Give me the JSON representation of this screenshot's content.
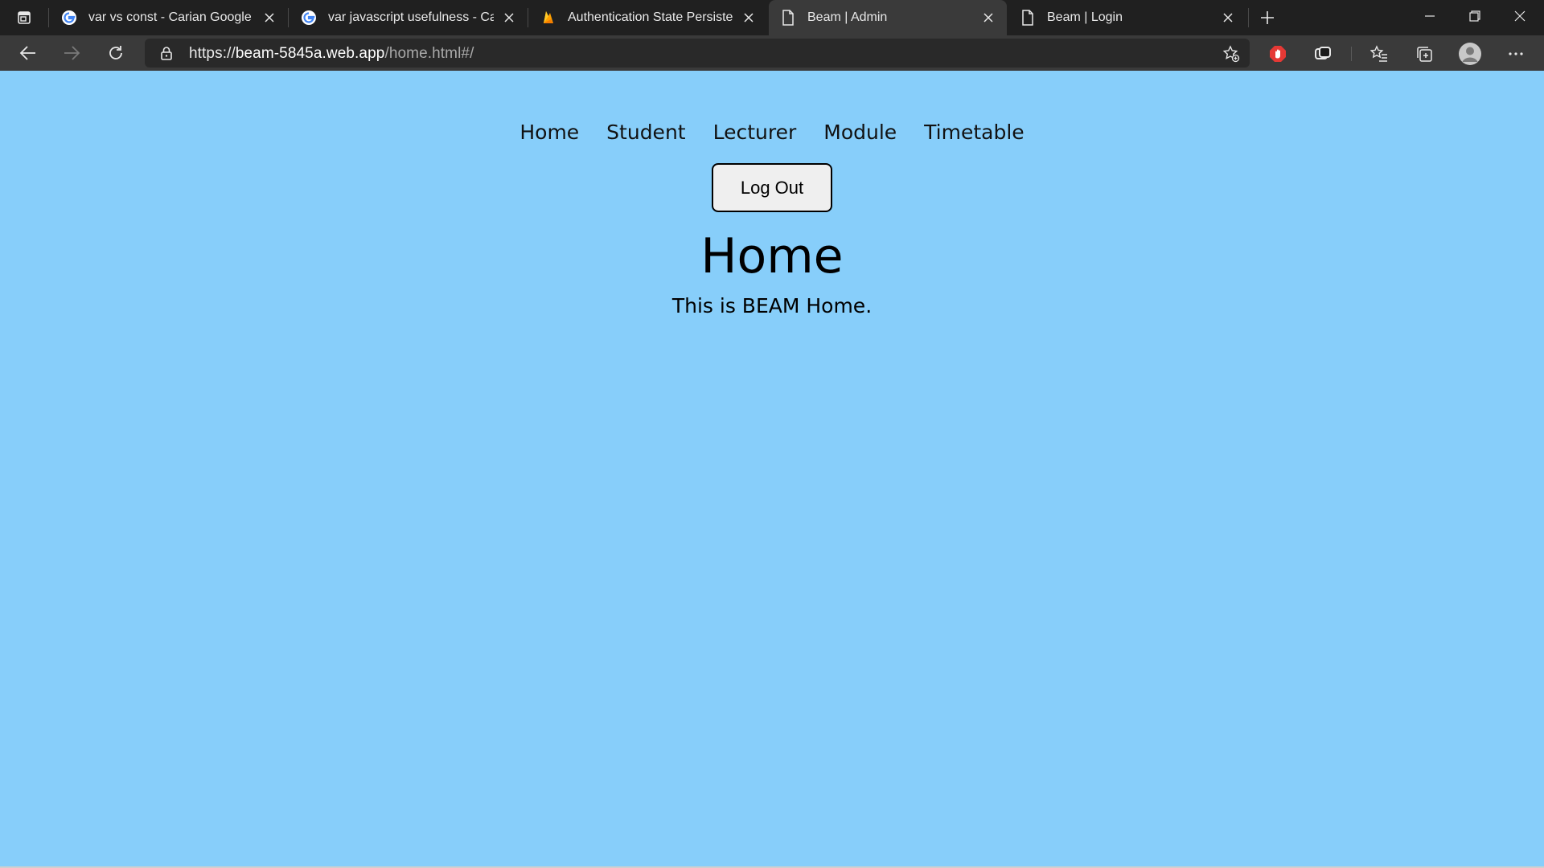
{
  "browser": {
    "tabs": [
      {
        "title": "var vs const - Carian Google",
        "favicon": "google-g-icon",
        "active": false
      },
      {
        "title": "var javascript usefulness - Carian",
        "favicon": "google-g-icon",
        "active": false
      },
      {
        "title": "Authentication State Persistence",
        "favicon": "firebase-flame-icon",
        "active": false
      },
      {
        "title": "Beam | Admin",
        "favicon": "page-icon",
        "active": true
      },
      {
        "title": "Beam | Login",
        "favicon": "page-icon",
        "active": false
      }
    ],
    "url": {
      "scheme": "https://",
      "host": "beam-5845a.web.app",
      "path": "/home.html#/"
    }
  },
  "page": {
    "nav": [
      "Home",
      "Student",
      "Lecturer",
      "Module",
      "Timetable"
    ],
    "logout_label": "Log Out",
    "heading": "Home",
    "subtext": "This is BEAM Home."
  },
  "colors": {
    "page_background": "#87cefa",
    "browser_chrome": "#202020",
    "toolbar": "#3a3a3a"
  }
}
